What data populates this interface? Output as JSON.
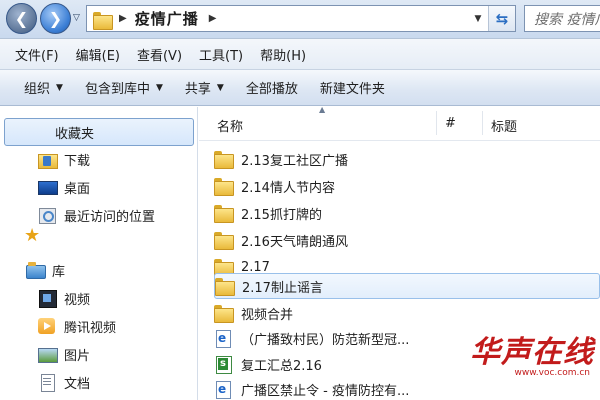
{
  "address_bar": {
    "path": "疫情广播",
    "search_placeholder": "搜索 疫情广播"
  },
  "menu_bar": {
    "items": [
      "文件(F)",
      "编辑(E)",
      "查看(V)",
      "工具(T)",
      "帮助(H)"
    ]
  },
  "command_bar": {
    "items": [
      {
        "label": "组织",
        "dropdown": true
      },
      {
        "label": "包含到库中",
        "dropdown": true
      },
      {
        "label": "共享",
        "dropdown": true
      },
      {
        "label": "全部播放",
        "dropdown": false
      },
      {
        "label": "新建文件夹",
        "dropdown": false
      }
    ]
  },
  "nav_pane": {
    "favorites": {
      "label": "收藏夹",
      "icon": "star-icon"
    },
    "favorite_items": [
      {
        "label": "下载",
        "icon": "download-folder-icon"
      },
      {
        "label": "桌面",
        "icon": "desktop-icon"
      },
      {
        "label": "最近访问的位置",
        "icon": "recent-places-icon"
      }
    ],
    "library": {
      "label": "库",
      "icon": "library-icon"
    },
    "library_items": [
      {
        "label": "视频",
        "icon": "video-library-icon"
      },
      {
        "label": "腾讯视频",
        "icon": "tencent-video-icon"
      },
      {
        "label": "图片",
        "icon": "pictures-library-icon"
      },
      {
        "label": "文档",
        "icon": "documents-library-icon"
      }
    ]
  },
  "file_list": {
    "columns": {
      "name": "名称",
      "number": "#",
      "title": "标题"
    },
    "rows": [
      {
        "name": "2.13复工社区广播",
        "type": "folder"
      },
      {
        "name": "2.14情人节内容",
        "type": "folder"
      },
      {
        "name": "2.15抓打牌的",
        "type": "folder"
      },
      {
        "name": "2.16天气晴朗通风",
        "type": "folder"
      },
      {
        "name": "2.17",
        "type": "folder"
      },
      {
        "name": "2.17制止谣言",
        "type": "folder",
        "selected": true
      },
      {
        "name": "视频合并",
        "type": "folder"
      },
      {
        "name": "（广播致村民）防范新型冠...",
        "type": "ie-document"
      },
      {
        "name": "复工汇总2.16",
        "type": "spreadsheet"
      },
      {
        "name": "广播区禁止令 - 疫情防控有...",
        "type": "ie-document"
      }
    ]
  },
  "watermark": {
    "logo": "华声在线",
    "url": "www.voc.com.cn"
  },
  "colors": {
    "accent": "#3c7fd5",
    "selection_border": "#99c0ea",
    "watermark": "#c21b1b"
  }
}
